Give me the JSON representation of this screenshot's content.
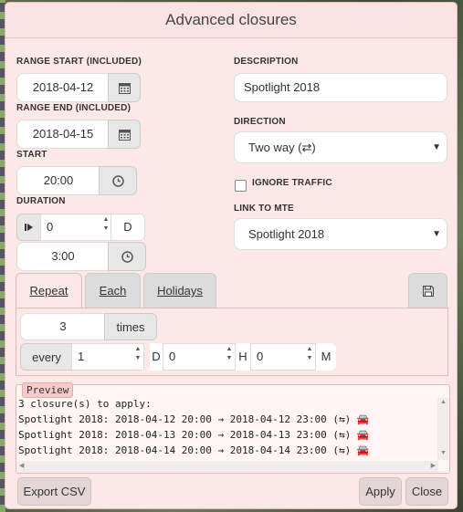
{
  "title": "Advanced closures",
  "labels": {
    "range_start": "RANGE START (INCLUDED)",
    "range_end": "RANGE END (INCLUDED)",
    "start": "START",
    "duration": "DURATION",
    "description": "DESCRIPTION",
    "direction": "DIRECTION",
    "ignore_traffic": "IGNORE TRAFFIC",
    "link_to_mte": "LINK TO MTE"
  },
  "values": {
    "range_start": "2018-04-12",
    "range_end": "2018-04-15",
    "start": "20:00",
    "duration_days": "0",
    "duration_days_unit": "D",
    "duration_time": "3:00",
    "description": "Spotlight 2018",
    "direction": "Two way (⇄)",
    "ignore_traffic_checked": false,
    "link_to_mte": "Spotlight 2018"
  },
  "tabs": [
    {
      "label": "Repeat",
      "active": true
    },
    {
      "label": "Each",
      "active": false
    },
    {
      "label": "Holidays",
      "active": false
    }
  ],
  "repeat": {
    "times_value": "3",
    "times_label": "times",
    "every_label": "every",
    "days_value": "1",
    "days_unit": "D",
    "hours_value": "0",
    "hours_unit": "H",
    "minutes_value": "0",
    "minutes_unit": "M"
  },
  "preview": {
    "tag": "Preview",
    "summary": "3 closure(s) to apply:",
    "lines": [
      "Spotlight 2018: 2018-04-12 20:00 → 2018-04-12 23:00 (⇆)",
      "Spotlight 2018: 2018-04-13 20:00 → 2018-04-13 23:00 (⇆)",
      "Spotlight 2018: 2018-04-14 20:00 → 2018-04-14 23:00 (⇆)"
    ]
  },
  "buttons": {
    "export_csv": "Export CSV",
    "apply": "Apply",
    "close": "Close"
  },
  "icons": {
    "calendar": "calendar-icon",
    "clock": "clock-icon",
    "save": "floppy-disk-icon",
    "car": "car-icon"
  }
}
